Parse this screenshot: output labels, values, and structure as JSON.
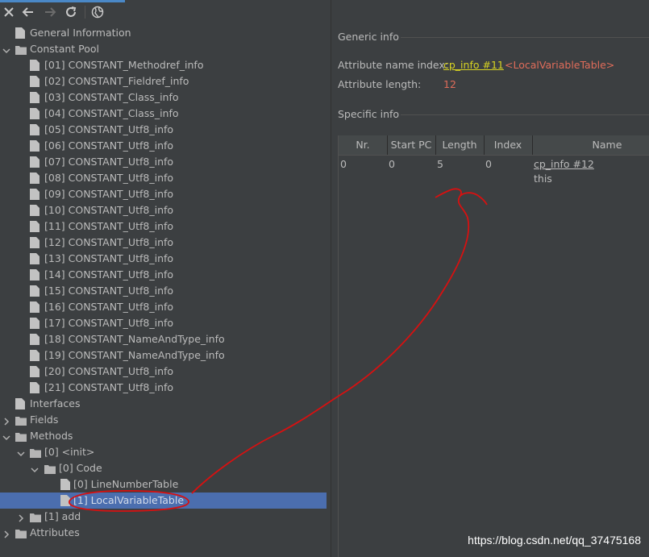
{
  "tree": {
    "general_information": "General Information",
    "constant_pool": "Constant Pool",
    "constants": [
      "[01] CONSTANT_Methodref_info",
      "[02] CONSTANT_Fieldref_info",
      "[03] CONSTANT_Class_info",
      "[04] CONSTANT_Class_info",
      "[05] CONSTANT_Utf8_info",
      "[06] CONSTANT_Utf8_info",
      "[07] CONSTANT_Utf8_info",
      "[08] CONSTANT_Utf8_info",
      "[09] CONSTANT_Utf8_info",
      "[10] CONSTANT_Utf8_info",
      "[11] CONSTANT_Utf8_info",
      "[12] CONSTANT_Utf8_info",
      "[13] CONSTANT_Utf8_info",
      "[14] CONSTANT_Utf8_info",
      "[15] CONSTANT_Utf8_info",
      "[16] CONSTANT_Utf8_info",
      "[17] CONSTANT_Utf8_info",
      "[18] CONSTANT_NameAndType_info",
      "[19] CONSTANT_NameAndType_info",
      "[20] CONSTANT_Utf8_info",
      "[21] CONSTANT_Utf8_info"
    ],
    "interfaces": "Interfaces",
    "fields": "Fields",
    "methods": "Methods",
    "method_init": "[0] <init>",
    "code": "[0] Code",
    "line_number_table": "[0] LineNumberTable",
    "local_variable_table": "[1] LocalVariableTable",
    "method_add": "[1] add",
    "attributes": "Attributes"
  },
  "generic": {
    "title": "Generic info",
    "name_index_label": "Attribute name index:",
    "name_index_link": "cp_info #11",
    "name_index_value": "<LocalVariableTable>",
    "length_label": "Attribute length:",
    "length_value": "12"
  },
  "specific": {
    "title": "Specific info",
    "columns": [
      "Nr.",
      "Start PC",
      "Length",
      "Index",
      "Name"
    ],
    "row": {
      "nr": "0",
      "start_pc": "0",
      "length": "5",
      "index": "0",
      "name_link": "cp_info #12",
      "name_value": "this"
    }
  },
  "watermark": "https://blog.csdn.net/qq_37475168",
  "colors": {
    "background": "#3c3f41",
    "selection": "#4b6eaf",
    "link": "#d7d322",
    "value_red": "#e06c5a",
    "annotation": "#e01010"
  }
}
